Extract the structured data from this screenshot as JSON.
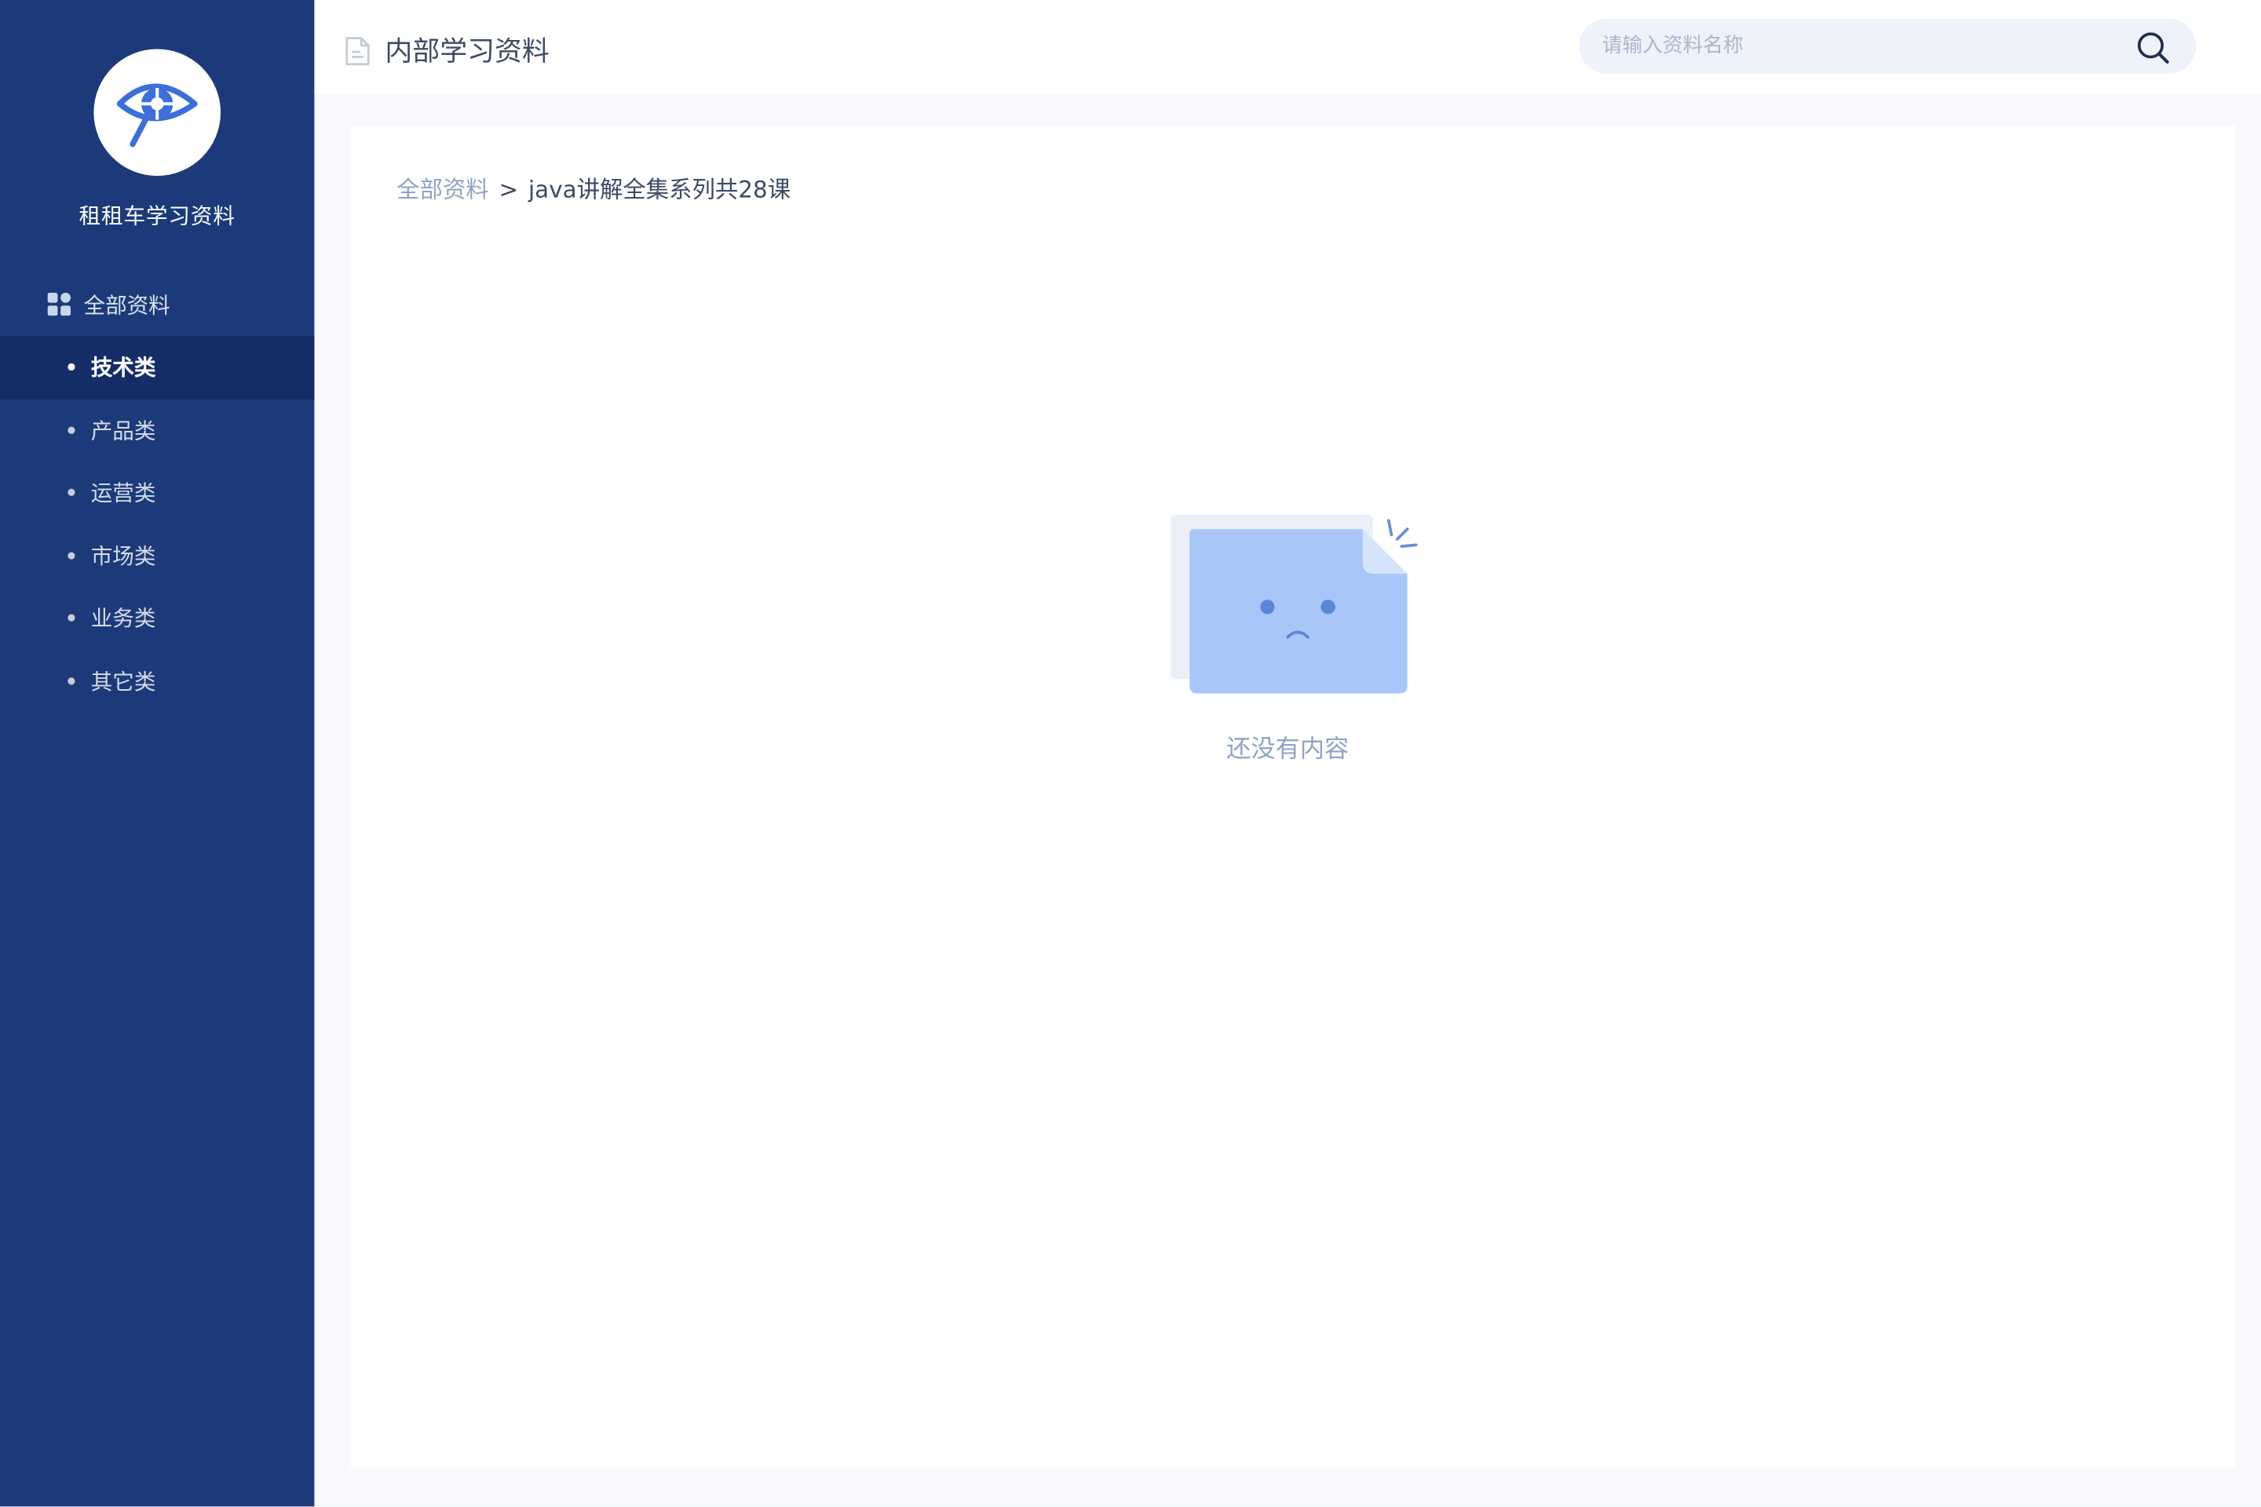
{
  "sidebar": {
    "brand_name": "租租车学习资料",
    "all_label": "全部资料",
    "categories": [
      {
        "label": "技术类",
        "active": true
      },
      {
        "label": "产品类",
        "active": false
      },
      {
        "label": "运营类",
        "active": false
      },
      {
        "label": "市场类",
        "active": false
      },
      {
        "label": "业务类",
        "active": false
      },
      {
        "label": "其它类",
        "active": false
      }
    ]
  },
  "header": {
    "title": "内部学习资料",
    "search_placeholder": "请输入资料名称"
  },
  "breadcrumb": {
    "root": "全部资料",
    "separator": ">",
    "current": "java讲解全集系列共28课"
  },
  "empty_state": {
    "text": "还没有内容"
  },
  "icons": {
    "logo": "eye-search-logo-icon",
    "all": "grid-icon",
    "title": "document-icon",
    "search": "search-icon",
    "empty": "empty-folder-sad-icon"
  },
  "colors": {
    "sidebar_bg": "#1c3a7a",
    "sidebar_active_bg": "#142d66",
    "accent": "#3d6fd9",
    "muted_text": "#8fa3c4",
    "body_text": "#3b4a66"
  }
}
